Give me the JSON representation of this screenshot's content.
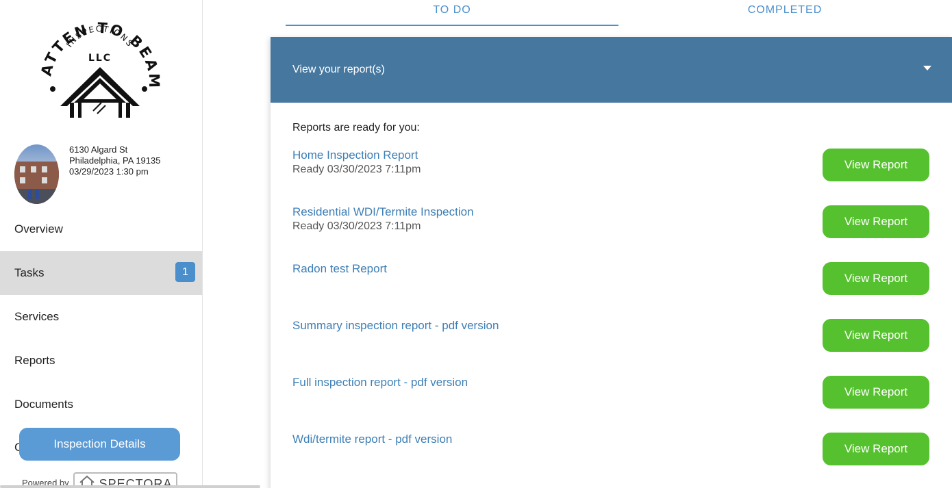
{
  "sidebar": {
    "logo": {
      "arc_text": "BATTEN TO BEAM",
      "inner_arc_text": "INSPECTIONS",
      "llc_text": "LLC"
    },
    "property": {
      "address_line1": "6130 Algard St",
      "address_line2": "Philadelphia, PA 19135",
      "datetime": "03/29/2023 1:30 pm"
    },
    "nav": [
      {
        "label": "Overview"
      },
      {
        "label": "Tasks",
        "badge": "1",
        "active": true
      },
      {
        "label": "Services"
      },
      {
        "label": "Reports"
      },
      {
        "label": "Documents"
      }
    ],
    "partial_nav_label": "C",
    "inspection_details_button": "Inspection Details",
    "powered_by": "Powered by",
    "brand": "SPECTORA"
  },
  "tabs": [
    {
      "label": "TO DO",
      "active": true
    },
    {
      "label": "COMPLETED"
    }
  ],
  "panel": {
    "header": "View your report(s)",
    "intro": "Reports are ready for you:",
    "view_button_label": "View Report",
    "reports": [
      {
        "title": "Home Inspection Report",
        "status": "Ready 03/30/2023 7:11pm"
      },
      {
        "title": "Residential WDI/Termite Inspection",
        "status": "Ready 03/30/2023 7:11pm"
      },
      {
        "title": "Radon test Report",
        "status": ""
      },
      {
        "title": "Summary inspection report - pdf version",
        "status": ""
      },
      {
        "title": "Full inspection report - pdf version",
        "status": ""
      },
      {
        "title": "Wdi/termite report - pdf version",
        "status": ""
      }
    ]
  },
  "colors": {
    "accent_blue": "#4a8fcc",
    "header_blue": "#46779e",
    "button_green": "#56c12e",
    "link_blue": "#3d7eb5"
  }
}
